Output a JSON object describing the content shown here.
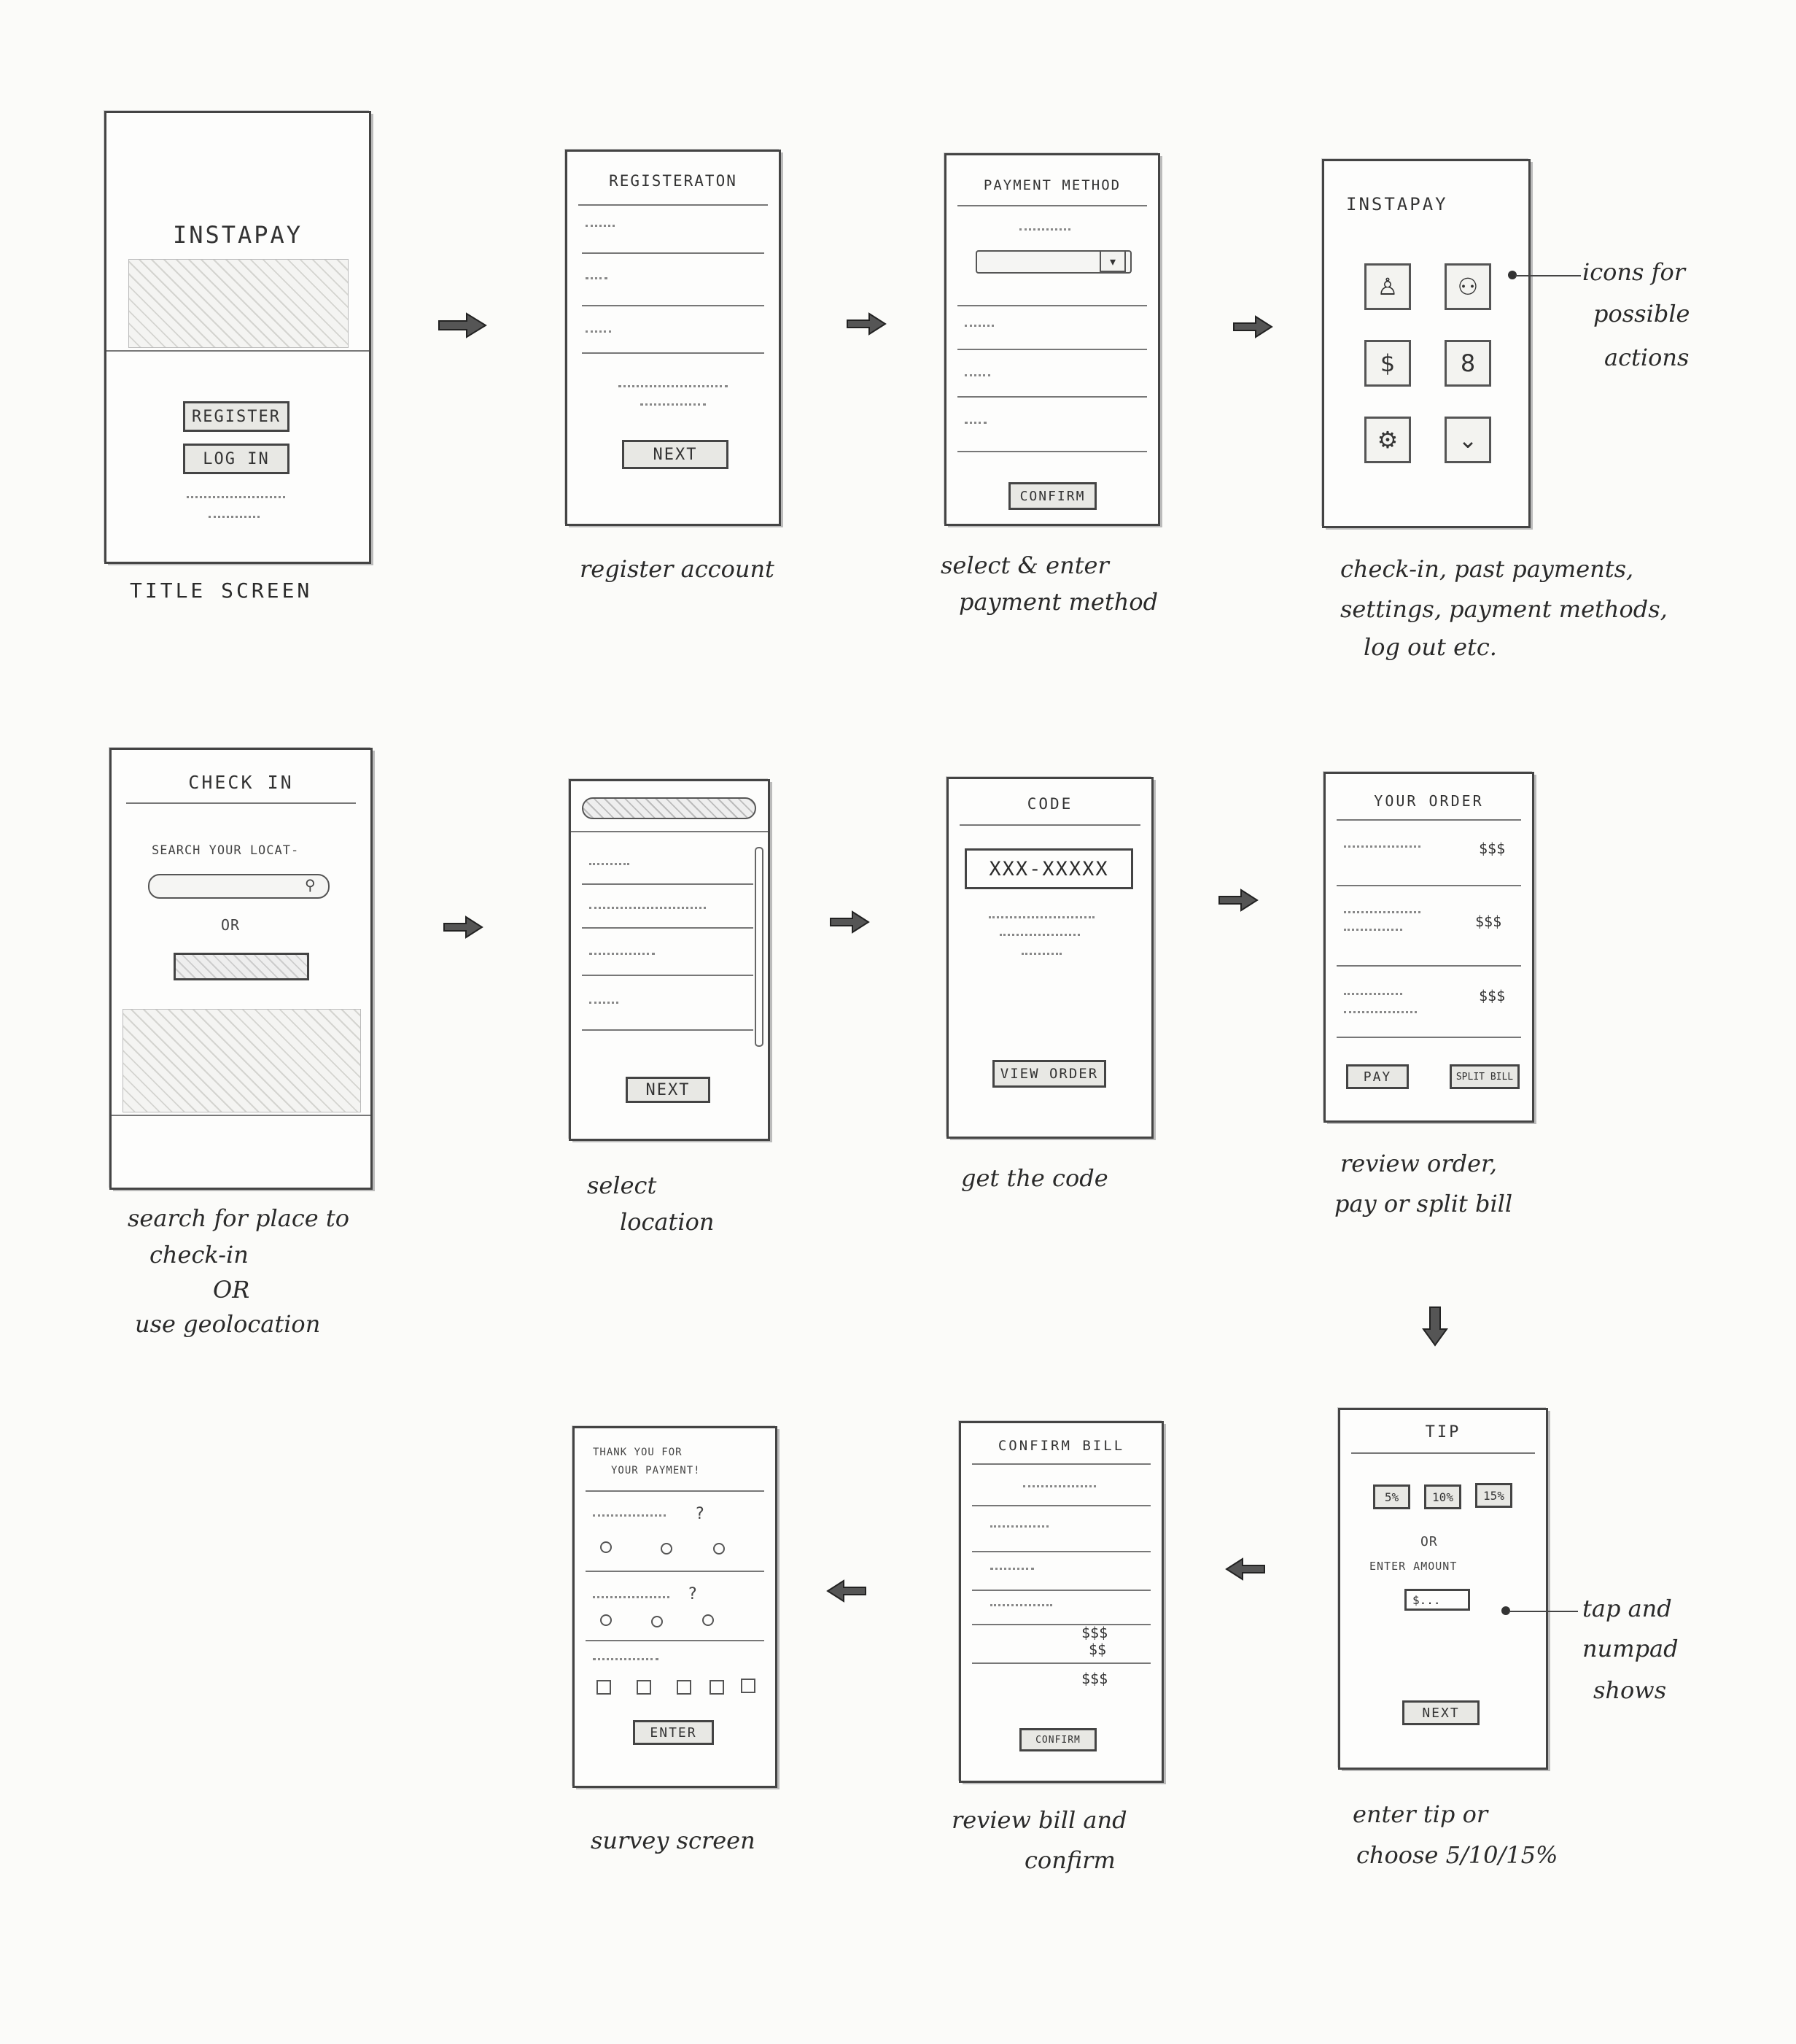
{
  "app_name": "INSTAPAY",
  "screens": {
    "title": {
      "title": "INSTAPAY",
      "register_button": "REGISTER",
      "login_button": "LOG IN",
      "caption": "TITLE SCREEN"
    },
    "registration": {
      "title": "REGISTERATON",
      "next_button": "NEXT",
      "caption": "register account"
    },
    "payment_method": {
      "title": "PAYMENT METHOD",
      "confirm_button": "CONFIRM",
      "caption_line1": "select & enter",
      "caption_line2": "payment method"
    },
    "home": {
      "title": "INSTAPAY",
      "icons": [
        "icon-a",
        "people-icon",
        "dollar-icon",
        "icon-8",
        "gear-icon",
        "chevron-down-icon"
      ],
      "annotation_line1": "icons for",
      "annotation_line2": "possible",
      "annotation_line3": "actions",
      "caption_line1": "check-in, past payments,",
      "caption_line2": "settings, payment methods,",
      "caption_line3": "log out etc."
    },
    "check_in": {
      "title": "CHECK IN",
      "search_label": "SEARCH YOUR LOCAT-",
      "or_text": "OR",
      "caption_line1": "search for place to",
      "caption_line2": "check-in",
      "caption_line3": "OR",
      "caption_line4": "use geolocation"
    },
    "select_location": {
      "next_button": "NEXT",
      "caption_line1": "select",
      "caption_line2": "location"
    },
    "code": {
      "title": "CODE",
      "code_value": "XXX-XXXXX",
      "view_order_button": "VIEW ORDER",
      "caption": "get the code"
    },
    "your_order": {
      "title": "YOUR ORDER",
      "prices": [
        "$$$",
        "$$$",
        "$$$"
      ],
      "pay_button": "PAY",
      "split_bill_button": "SPLIT BILL",
      "caption_line1": "review order,",
      "caption_line2": "pay or split bill"
    },
    "tip": {
      "title": "TIP",
      "options": [
        "5%",
        "10%",
        "15%"
      ],
      "or_text": "OR",
      "enter_amount_label": "ENTER AMOUNT",
      "amount_value": "$...",
      "next_button": "NEXT",
      "annotation_line1": "tap and",
      "annotation_line2": "numpad",
      "annotation_line3": "shows",
      "caption_line1": "enter tip or",
      "caption_line2": "choose 5/10/15%"
    },
    "confirm_bill": {
      "title": "CONFIRM BILL",
      "total_lines": [
        "$$$",
        "$$",
        "$$$"
      ],
      "confirm_button": "CONFIRM",
      "caption_line1": "review bill and",
      "caption_line2": "confirm"
    },
    "survey": {
      "title_line1": "THANK YOU FOR",
      "title_line2": "YOUR PAYMENT!",
      "enter_button": "ENTER",
      "caption": "survey screen"
    }
  },
  "colors": {
    "paper": "#fbfbf9",
    "pencil": "#444444"
  }
}
